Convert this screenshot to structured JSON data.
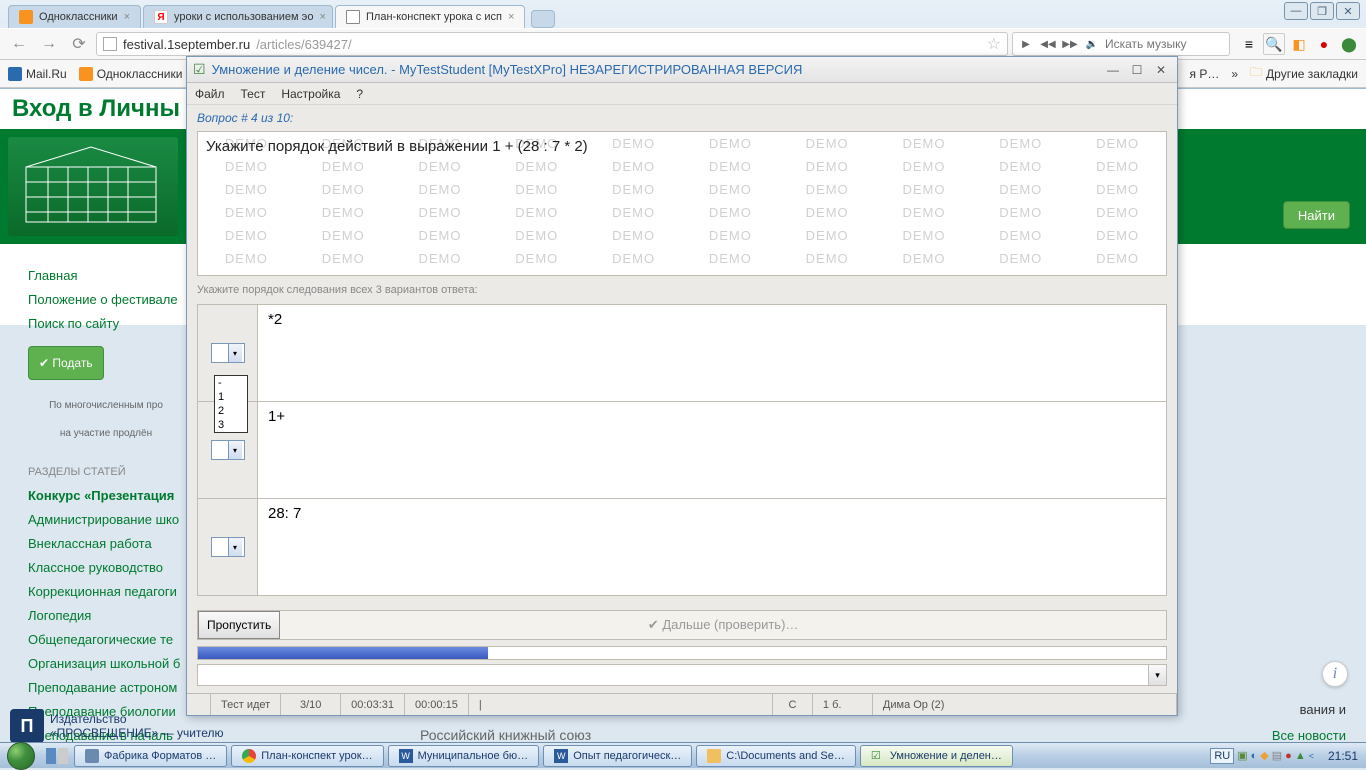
{
  "browser": {
    "tabs": [
      {
        "label": "Одноклассники",
        "fav_color": "#f7931e"
      },
      {
        "label": "уроки с использованием эо",
        "fav_color": "#ff0000"
      },
      {
        "label": "План-конспект урока с исп",
        "fav_color": "#888888",
        "active": true
      }
    ],
    "nav": {
      "back": "←",
      "fwd": "→",
      "reload": "⟳"
    },
    "address": {
      "domain": "festival.1september.ru",
      "path": "/articles/639427/"
    },
    "music_placeholder": "Искать музыку",
    "bookmarks": [
      {
        "label": "Mail.Ru"
      },
      {
        "label": "Одноклассники"
      }
    ],
    "bm_right": "я Р…",
    "bm_more": "»",
    "bm_other": "Другие закладки"
  },
  "page": {
    "heading": "Вход в Личны",
    "find": "Найти",
    "sidebar": {
      "links1": [
        "Главная",
        "Положение о фестивале",
        "Поиск по сайту"
      ],
      "submit": "✔ Подать",
      "note1": "По многочисленным про",
      "note2": "на участие продлён",
      "section": "РАЗДЕЛЫ СТАТЕЙ",
      "links2": [
        "Конкурс «Презентация",
        "Администрирование шко",
        "Внеклассная работа",
        "Классное руководство",
        "Коррекционная педагоги",
        "Логопедия",
        "Общепедагогические те",
        "Организация школьной б",
        "Преподавание астроном",
        "Преподавание биологии",
        "Преподавание в началь"
      ]
    },
    "publisher1": "Издательство",
    "publisher2": "«ПРОСВЕЩЕНИЕ» — учителю",
    "rks": "Российский книжный союз",
    "vania": "вания и",
    "all_news": "Все новости"
  },
  "app": {
    "title": "Умножение и деление чисел. - MyTestStudent [MyTestXPro] НЕЗАРЕГИСТРИРОВАННАЯ ВЕРСИЯ",
    "menu": [
      "Файл",
      "Тест",
      "Настройка",
      "?"
    ],
    "q_label": "Вопрос # 4 из 10:",
    "q_text": "Укажите порядок действий в выражении 1 + (28 : 7 * 2)",
    "demo": "DEMO",
    "instruction": "Укажите порядок следования всех 3 вариантов ответа:",
    "answers": [
      "*2",
      "1+",
      "28: 7"
    ],
    "dropdown_options": [
      "-",
      "1",
      "2",
      "3"
    ],
    "skip": "Пропустить",
    "next": "✔ Дальше (проверить)…",
    "status": {
      "running": "Тест идет",
      "progress": "3/10",
      "time1": "00:03:31",
      "time2": "00:00:15",
      "sep": "|",
      "c": "C",
      "pts": "1 б.",
      "user": "Дима Ор (2)"
    }
  },
  "taskbar": {
    "items": [
      "Фабрика Форматов …",
      "План-конспект урок…",
      "Муниципальное бю…",
      "Опыт педагогическ…",
      "C:\\Documents and Se…",
      "Умножение и делен…"
    ],
    "lang": "RU",
    "clock": "21:51"
  }
}
